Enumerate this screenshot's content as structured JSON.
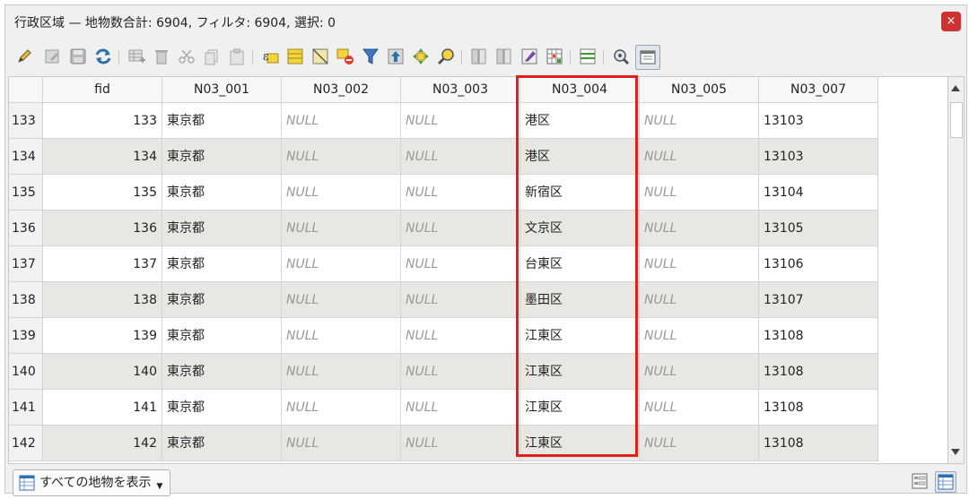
{
  "window": {
    "title": "行政区域 — 地物数合計: 6904, フィルタ: 6904, 選択: 0",
    "close_label": "×"
  },
  "toolbar": {
    "icons": [
      "pencil-icon",
      "multi-edit-icon",
      "save-icon",
      "reload-icon",
      "add-feature-icon",
      "delete-icon",
      "cut-icon",
      "copy-icon",
      "paste-icon",
      "expression-select-icon",
      "select-all-icon",
      "deselect-icon",
      "invert-selection-icon",
      "filter-icon",
      "move-selection-top-icon",
      "pan-to-selection-icon",
      "zoom-to-selection-icon",
      "new-field-icon",
      "delete-field-icon",
      "field-calculator-icon",
      "table-conditional-icon",
      "organize-columns-icon",
      "actions-icon",
      "dock-icon"
    ]
  },
  "table": {
    "columns": [
      "fid",
      "N03_001",
      "N03_002",
      "N03_003",
      "N03_004",
      "N03_005",
      "N03_007"
    ],
    "rows": [
      {
        "rn": "133",
        "fid": "133",
        "n001": "東京都",
        "n002": "NULL",
        "n003": "NULL",
        "n004": "港区",
        "n005": "NULL",
        "n007": "13103"
      },
      {
        "rn": "134",
        "fid": "134",
        "n001": "東京都",
        "n002": "NULL",
        "n003": "NULL",
        "n004": "港区",
        "n005": "NULL",
        "n007": "13103"
      },
      {
        "rn": "135",
        "fid": "135",
        "n001": "東京都",
        "n002": "NULL",
        "n003": "NULL",
        "n004": "新宿区",
        "n005": "NULL",
        "n007": "13104"
      },
      {
        "rn": "136",
        "fid": "136",
        "n001": "東京都",
        "n002": "NULL",
        "n003": "NULL",
        "n004": "文京区",
        "n005": "NULL",
        "n007": "13105"
      },
      {
        "rn": "137",
        "fid": "137",
        "n001": "東京都",
        "n002": "NULL",
        "n003": "NULL",
        "n004": "台東区",
        "n005": "NULL",
        "n007": "13106"
      },
      {
        "rn": "138",
        "fid": "138",
        "n001": "東京都",
        "n002": "NULL",
        "n003": "NULL",
        "n004": "墨田区",
        "n005": "NULL",
        "n007": "13107"
      },
      {
        "rn": "139",
        "fid": "139",
        "n001": "東京都",
        "n002": "NULL",
        "n003": "NULL",
        "n004": "江東区",
        "n005": "NULL",
        "n007": "13108"
      },
      {
        "rn": "140",
        "fid": "140",
        "n001": "東京都",
        "n002": "NULL",
        "n003": "NULL",
        "n004": "江東区",
        "n005": "NULL",
        "n007": "13108"
      },
      {
        "rn": "141",
        "fid": "141",
        "n001": "東京都",
        "n002": "NULL",
        "n003": "NULL",
        "n004": "江東区",
        "n005": "NULL",
        "n007": "13108"
      },
      {
        "rn": "142",
        "fid": "142",
        "n001": "東京都",
        "n002": "NULL",
        "n003": "NULL",
        "n004": "江東区",
        "n005": "NULL",
        "n007": "13108"
      }
    ],
    "highlight_color": "#e0201c"
  },
  "footer": {
    "filter_button_label": "すべての地物を表示"
  }
}
